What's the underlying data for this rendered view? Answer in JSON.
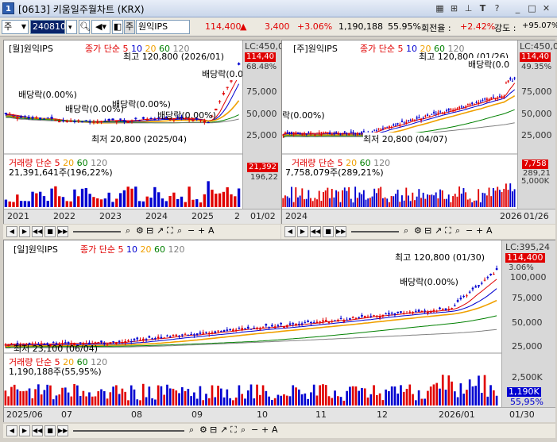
{
  "window": {
    "title": "[0613] 키움일주월차트 (KRX)",
    "icon_label": "1"
  },
  "quote": {
    "market": "주",
    "code": "240810",
    "name": "원익IPS",
    "price": "114,400",
    "change": "3,400",
    "change_pct": "+3.06%",
    "volume": "1,190,188",
    "volume_pct": "55.95%",
    "turnover_label": "회전율 :",
    "turnover": "+2.42%",
    "strength_label": "강도 :",
    "strength": "+95.07%"
  },
  "colors": {
    "up": "#e00000",
    "down": "#0000d0",
    "ma5": "#e00000",
    "ma10": "#0000d0",
    "ma20": "#f0a000",
    "ma60": "#008000",
    "ma120": "#808080"
  },
  "common": {
    "ma_label": "종가 단순",
    "ma5": "5",
    "ma10": "10",
    "ma20": "20",
    "ma60": "60",
    "ma120": "120",
    "vol_label": "거래량",
    "vol_ma_label": "단순",
    "vol_ma5": "5",
    "vol_ma20": "20",
    "vol_ma60": "60",
    "vol_ma120": "120"
  },
  "monthly": {
    "title": "[월]원익IPS",
    "lc": "LC:450,0",
    "price_badge": "114,40",
    "pct": "68.48%",
    "y_ticks": [
      "75,000",
      "50,000",
      "25,000"
    ],
    "high": "최고 120,800 (2026/01)",
    "low": "최저 20,800 (2025/04)",
    "dividends": [
      "배당락(0.00%)",
      "배당락(0.00%)",
      "배당락(0.00%)",
      "배당락(0.00%)",
      "배당락(0.00%)",
      "배당락(0.00%)"
    ],
    "volume_text": "21,391,641주(196,22%)",
    "vol_badge": "21,392",
    "vol_pct": "196,22",
    "x_ticks": [
      "2021",
      "2022",
      "2023",
      "2024",
      "2025",
      "2"
    ],
    "x_end": "01/02"
  },
  "weekly": {
    "title": "[주]원익IPS",
    "lc": "LC:450,0",
    "price_badge": "114,40",
    "pct": "49.35%",
    "y_ticks": [
      "75,000",
      "50,000",
      "25,000"
    ],
    "high": "최고 120,800 (01/26)",
    "low": "최저 20,800 (04/07)",
    "dividends": [
      "배당락(0.00%)",
      "배당락(0.0",
      "락(0.00%)"
    ],
    "volume_text": "7,758,079주(289,21%)",
    "vol_badge": "7,758",
    "vol_pct": "289,21",
    "vol_ytick": "5,000K",
    "x_ticks": [
      "2024",
      "2026"
    ],
    "x_end": "01/26"
  },
  "daily": {
    "title": "[일]원익IPS",
    "lc": "LC:395,24",
    "price_badge": "114,400",
    "pct": "3.06%",
    "y_ticks": [
      "100,000",
      "75,000",
      "50,000",
      "25,000"
    ],
    "high": "최고 120,800 (01/30)",
    "low": "최저 23,100 (06/04)",
    "dividend": "배당락(0.00%)",
    "volume_text": "1,190,188주(55,95%)",
    "vol_badge": "1,190K",
    "vol_pct": "55,95%",
    "vol_ytick": "2,500K",
    "x_ticks": [
      "2025/06",
      "07",
      "08",
      "09",
      "10",
      "11",
      "12",
      "2026/01"
    ],
    "x_end": "01/30"
  }
}
